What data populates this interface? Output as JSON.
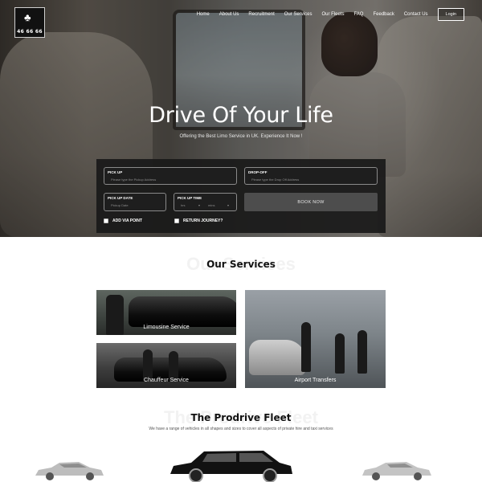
{
  "brand": {
    "phone": "46 66 66"
  },
  "nav": {
    "items": [
      "Home",
      "About Us",
      "Recruitment",
      "Our Services",
      "Our Fleets",
      "FAQ",
      "Feedback",
      "Contact Us"
    ],
    "login": "Login"
  },
  "hero": {
    "title": "Drive Of Your Life",
    "subtitle": "Offering the Best Limo Service in UK. Experience It Now !"
  },
  "booking": {
    "pickup_label": "PICK UP",
    "pickup_placeholder": "Please type the Pickup Address",
    "dropoff_label": "DROP-OFF",
    "dropoff_placeholder": "Please type the Drop Off Address",
    "date_label": "PICK UP DATE",
    "date_placeholder": "Pickup Date",
    "time_label": "PICK UP TIME",
    "time_hours": "hrs",
    "time_mins": "mins",
    "book_button": "BOOK NOW",
    "via_point": "ADD VIA POINT",
    "return_journey": "RETURN JOURNEY?"
  },
  "services": {
    "ghost": "Our Services",
    "title": "Our Services",
    "items": [
      "Limousine Service",
      "Chauffeur Service",
      "Airport Transfers"
    ]
  },
  "fleet": {
    "ghost": "The Prodrive Fleet",
    "title": "The Prodrive Fleet",
    "subtitle": "We have a range of vehicles in all shapes and sizes to cover all aspects of private hire and taxi services"
  }
}
